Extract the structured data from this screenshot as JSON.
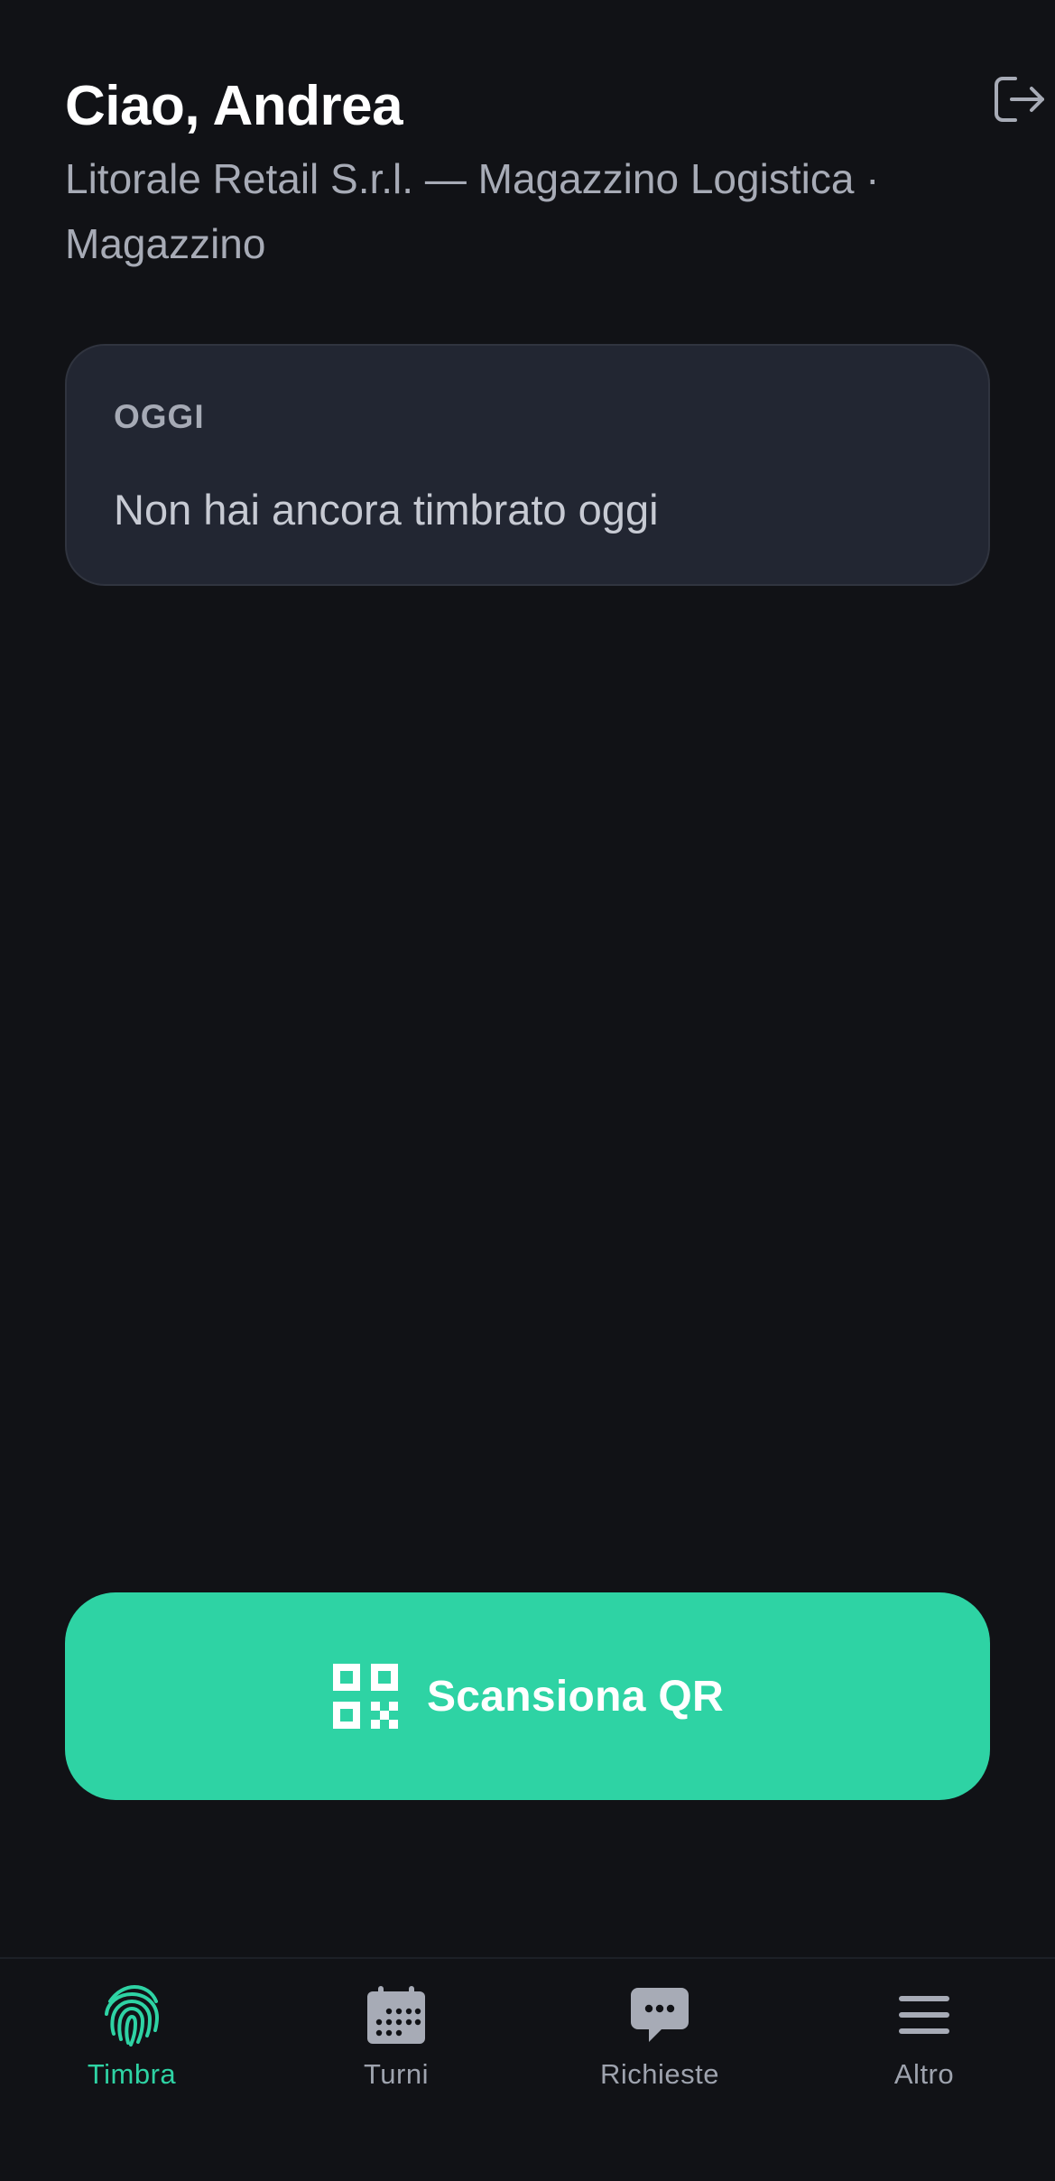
{
  "header": {
    "greeting": "Ciao, Andrea",
    "subtitle": "Litorale Retail S.r.l. — Magazzino Logistica · Magazzino",
    "logout_icon": "logout-icon"
  },
  "today": {
    "label": "OGGI",
    "status": "Non hai ancora timbrato oggi"
  },
  "scan": {
    "label": "Scansiona QR",
    "icon": "qr-code-icon"
  },
  "tabs": [
    {
      "label": "Timbra",
      "icon": "fingerprint-icon",
      "active": true
    },
    {
      "label": "Turni",
      "icon": "calendar-icon",
      "active": false
    },
    {
      "label": "Richieste",
      "icon": "chat-icon",
      "active": false
    },
    {
      "label": "Altro",
      "icon": "menu-icon",
      "active": false
    }
  ],
  "colors": {
    "background": "#111216",
    "card": "#222632",
    "accent": "#2ed3a4",
    "muted_text": "#a7abb6"
  }
}
